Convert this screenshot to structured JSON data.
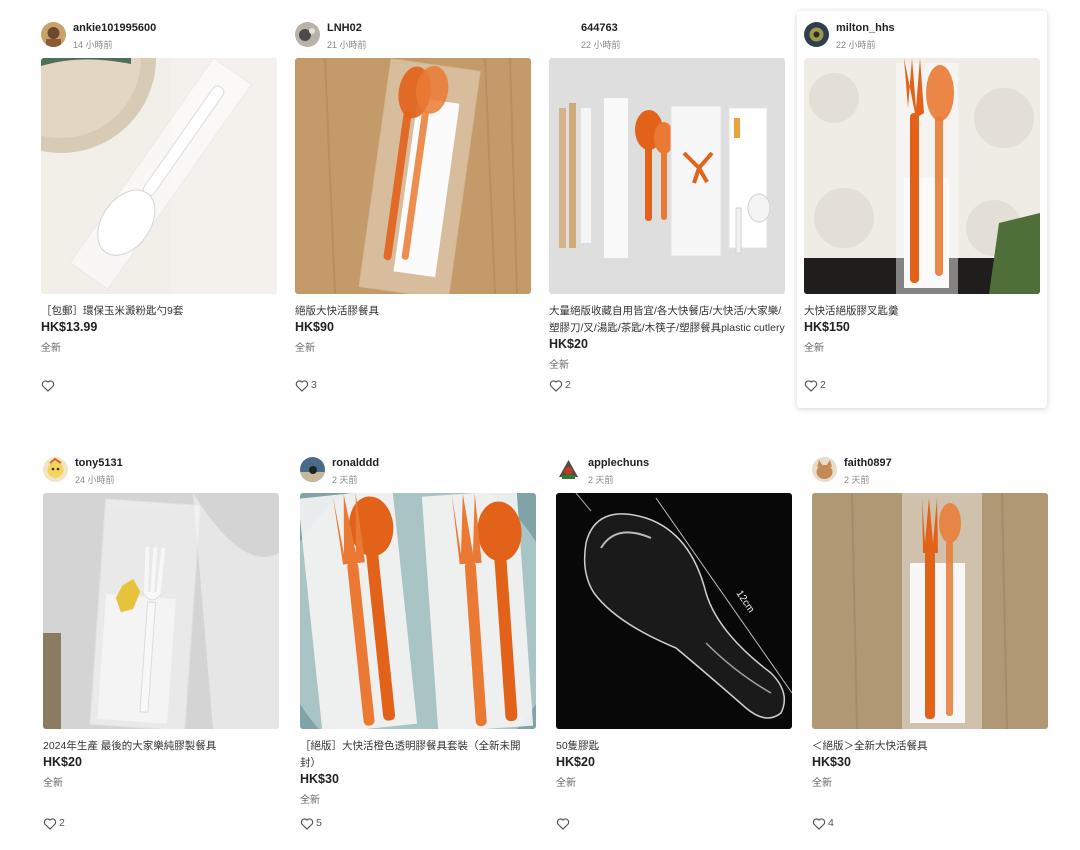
{
  "listings": [
    {
      "username": "ankie101995600",
      "time": "14 小時前",
      "title": "［包郵］環保玉米澱粉匙勺9套",
      "price": "HK$13.99",
      "condition": "全新",
      "likes": ""
    },
    {
      "username": "LNH02",
      "time": "21 小時前",
      "title": "絕版大快活膠餐具",
      "price": "HK$90",
      "condition": "全新",
      "likes": "3"
    },
    {
      "username": "644763",
      "time": "22 小時前",
      "title": "大量絕版收藏自用皆宜/各大快餐店/大快活/大家樂/塑膠刀/叉/湯匙/茶匙/木筷子/塑膠餐具plastic cutlery",
      "price": "HK$20",
      "condition": "全新",
      "likes": "2"
    },
    {
      "username": "milton_hhs",
      "time": "22 小時前",
      "title": "大快活絕版膠叉匙羹",
      "price": "HK$150",
      "condition": "全新",
      "likes": "2"
    },
    {
      "username": "tony5131",
      "time": "24 小時前",
      "title": "2024年生產 最後的大家樂純膠製餐具",
      "price": "HK$20",
      "condition": "全新",
      "likes": "2"
    },
    {
      "username": "ronalddd",
      "time": "2 天前",
      "title": "［絕版］大快活橙色透明膠餐具套裝（全新未開封）",
      "price": "HK$30",
      "condition": "全新",
      "likes": "5"
    },
    {
      "username": "applechuns",
      "time": "2 天前",
      "title": "50隻膠匙",
      "price": "HK$20",
      "condition": "全新",
      "likes": "",
      "image_label": "12cm"
    },
    {
      "username": "faith0897",
      "time": "2 天前",
      "title": "＜絕版＞全新大快活餐具",
      "price": "HK$30",
      "condition": "全新",
      "likes": "4"
    }
  ],
  "colors": {
    "accent_orange": "#e2621a",
    "text": "#222222",
    "muted": "#888888"
  },
  "icons": {
    "like": "heart-outline-icon"
  }
}
